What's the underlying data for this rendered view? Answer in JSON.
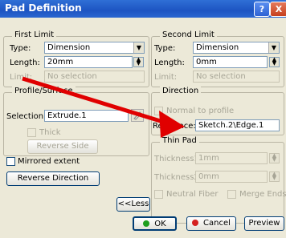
{
  "title": "Pad Definition",
  "title_buttons": {
    "help": "?",
    "close": "X"
  },
  "first_limit": {
    "group_label": "First Limit",
    "type_label": "Type:",
    "type_value": "Dimension",
    "length_label": "Length:",
    "length_value": "20mm",
    "limit_label": "Limit:",
    "limit_value": "No selection"
  },
  "profile_surface": {
    "group_label": "Profile/Surface",
    "selection_label": "Selection:",
    "selection_value": "Extrude.1",
    "thick_label": "Thick",
    "reverse_side": "Reverse Side"
  },
  "mirrored_extent": "Mirrored extent",
  "reverse_direction": "Reverse Direction",
  "less_button": "<<Less",
  "second_limit": {
    "group_label": "Second Limit",
    "type_label": "Type:",
    "type_value": "Dimension",
    "length_label": "Length:",
    "length_value": "0mm",
    "limit_label": "Limit:",
    "limit_value": "No selection"
  },
  "direction": {
    "group_label": "Direction",
    "normal_label": "Normal to profile",
    "reference_label": "Reference:",
    "reference_value": "Sketch.2\\Edge.1"
  },
  "thin_pad": {
    "group_label": "Thin Pad",
    "thickness1_label": "Thickness1:",
    "thickness1_value": "1mm",
    "thickness2_label": "Thickness2:",
    "thickness2_value": "0mm",
    "neutral_fiber": "Neutral Fiber",
    "merge_ends": "Merge Ends"
  },
  "footer": {
    "ok": "OK",
    "cancel": "Cancel",
    "preview": "Preview"
  },
  "colors": {
    "annotation_arrow": "#e00000",
    "title_bar": "#1d54c2"
  }
}
